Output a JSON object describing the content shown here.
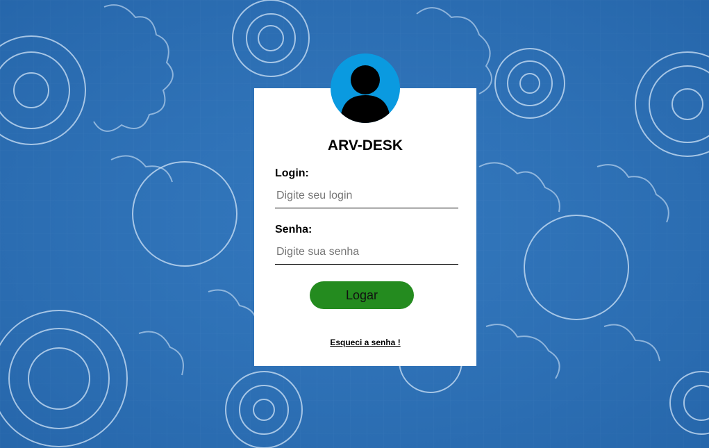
{
  "app": {
    "title": "ARV-DESK"
  },
  "login": {
    "label": "Login:",
    "placeholder": "Digite seu login",
    "value": ""
  },
  "password": {
    "label": "Senha:",
    "placeholder": "Digite sua senha",
    "value": ""
  },
  "actions": {
    "submit_label": "Logar",
    "forgot_label": "Esqueci a senha !"
  },
  "icons": {
    "avatar": "user-avatar-icon"
  },
  "colors": {
    "background": "#2f72b8",
    "avatar_bg": "#0a9ae0",
    "button": "#248b1f",
    "card": "#ffffff"
  }
}
